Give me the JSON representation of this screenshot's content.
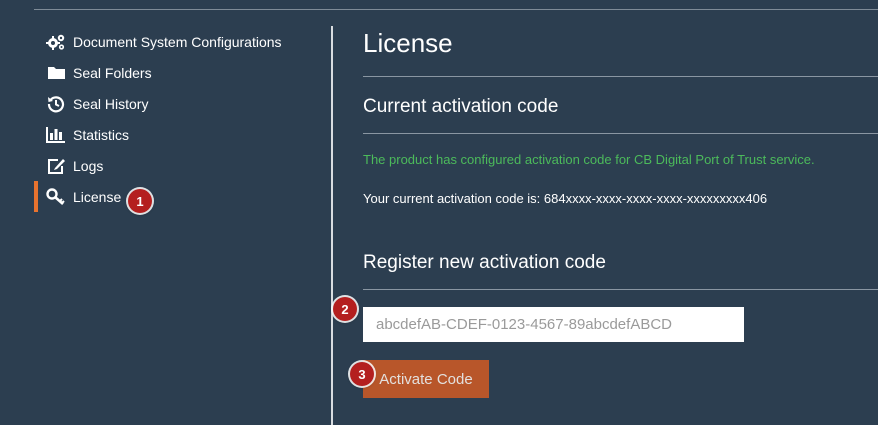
{
  "sidebar": {
    "items": [
      {
        "label": "Document System Configurations",
        "icon": "gears-icon"
      },
      {
        "label": "Seal Folders",
        "icon": "folder-icon"
      },
      {
        "label": "Seal History",
        "icon": "history-icon"
      },
      {
        "label": "Statistics",
        "icon": "bar-chart-icon"
      },
      {
        "label": "Logs",
        "icon": "edit-icon"
      },
      {
        "label": "License",
        "icon": "key-icon",
        "active": true
      }
    ]
  },
  "main": {
    "title": "License",
    "current": {
      "heading": "Current activation code",
      "status": "The product has configured activation code for CB Digital Port of Trust service.",
      "code_line": "Your current activation code is: 684xxxx-xxxx-xxxx-xxxx-xxxxxxxxx406"
    },
    "register": {
      "heading": "Register new activation code",
      "placeholder": "abcdefAB-CDEF-0123-4567-89abcdefABCD",
      "button_label": "Activate Code"
    }
  },
  "badges": [
    "1",
    "2",
    "3"
  ],
  "colors": {
    "background": "#2c3e50",
    "accent": "#e8732f",
    "button": "#b8562a",
    "status_green": "#4cba5b",
    "badge": "#b41f1f"
  }
}
